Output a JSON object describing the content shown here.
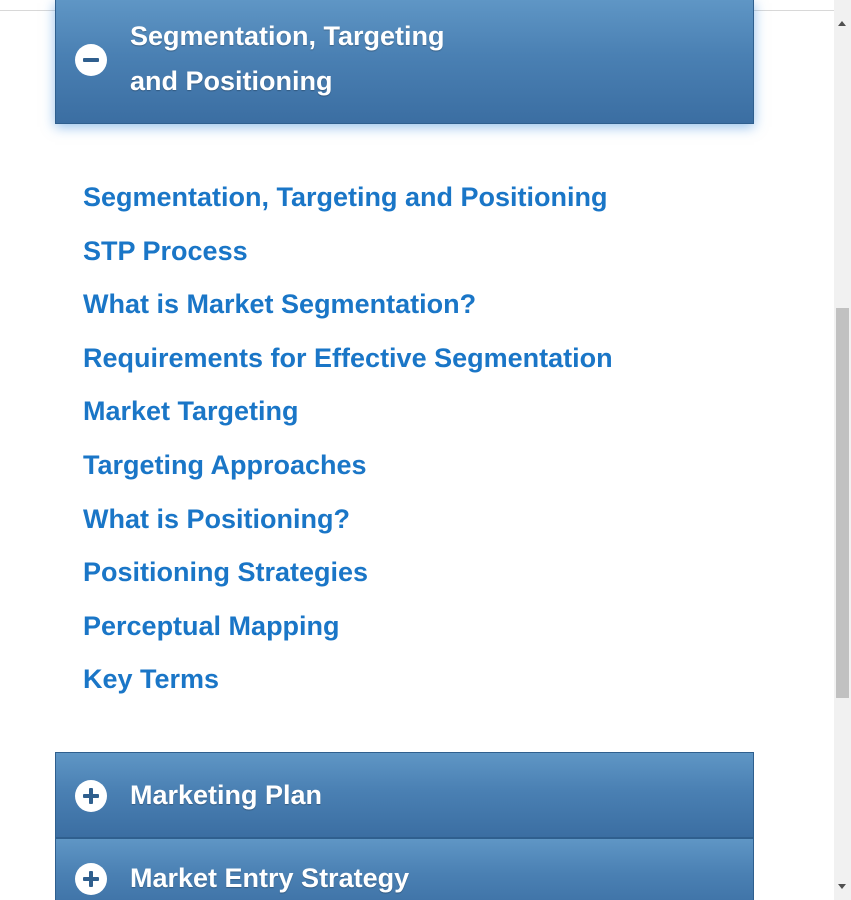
{
  "sections": {
    "current": {
      "title_line1": "Segmentation, Targeting",
      "title_line2": "and Positioning",
      "state_icon": "minus-circle-icon"
    },
    "next": [
      {
        "title": "Marketing Plan",
        "state_icon": "plus-circle-icon"
      },
      {
        "title": "Market Entry Strategy",
        "state_icon": "plus-circle-icon"
      }
    ]
  },
  "links": [
    "Segmentation, Targeting and Positioning",
    "STP Process",
    "What is Market Segmentation?",
    "Requirements for Effective Segmentation",
    "Market Targeting",
    "Targeting Approaches",
    "What is Positioning?",
    "Positioning Strategies",
    "Perceptual Mapping",
    "Key Terms"
  ],
  "colors": {
    "header_gradient_top": "#5f96c5",
    "header_gradient_bottom": "#3b6ea2",
    "link": "#1a76c7"
  },
  "scrollbar": {
    "up_icon": "scroll-up-arrow-icon",
    "down_icon": "scroll-down-arrow-icon"
  }
}
